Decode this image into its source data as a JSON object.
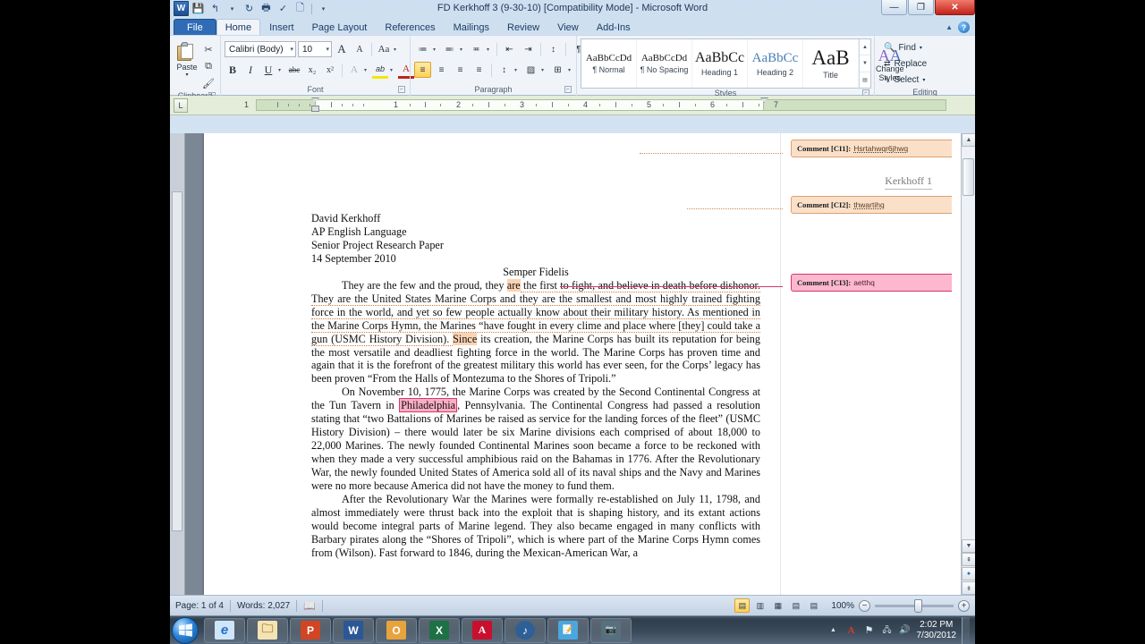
{
  "window": {
    "title": "FD Kerkhoff 3 (9-30-10) [Compatibility Mode]  -  Microsoft Word",
    "minimize_label": "—",
    "restore_label": "❐",
    "close_label": "✕",
    "help_label": "?",
    "collapse_ribbon_label": "▲"
  },
  "quick_access": {
    "items": [
      {
        "name": "word-logo",
        "glyph": "W"
      },
      {
        "name": "save",
        "glyph": "💾"
      },
      {
        "name": "undo",
        "glyph": "↰"
      },
      {
        "name": "undo-dropdown",
        "glyph": "▾"
      },
      {
        "name": "redo",
        "glyph": "↻"
      },
      {
        "name": "print",
        "glyph": "🖶"
      },
      {
        "name": "spelling",
        "glyph": "✓"
      },
      {
        "name": "new",
        "glyph": "🗋"
      },
      {
        "name": "customize",
        "glyph": "▾"
      }
    ]
  },
  "tabs": [
    {
      "label": "File",
      "active": false,
      "file": true
    },
    {
      "label": "Home",
      "active": true
    },
    {
      "label": "Insert",
      "active": false
    },
    {
      "label": "Page Layout",
      "active": false
    },
    {
      "label": "References",
      "active": false
    },
    {
      "label": "Mailings",
      "active": false
    },
    {
      "label": "Review",
      "active": false
    },
    {
      "label": "View",
      "active": false
    },
    {
      "label": "Add-Ins",
      "active": false
    }
  ],
  "ribbon": {
    "clipboard": {
      "group_label": "Clipboard",
      "paste_label": "Paste",
      "paste_arrow": "▾",
      "cut_label": "✂",
      "copy_label": "⧉",
      "format_painter_label": "🖌"
    },
    "font": {
      "group_label": "Font",
      "font_name": "Calibri (Body)",
      "font_size": "10",
      "grow_font": "A",
      "shrink_font": "A",
      "change_case": "Aa",
      "bold": "B",
      "italic": "I",
      "underline": "U",
      "strikethrough": "abc",
      "subscript": "x₂",
      "superscript": "x²",
      "clear_formatting": "A",
      "text_highlight": "ab",
      "font_color": "A",
      "dropdown_arrow": "▾"
    },
    "paragraph": {
      "group_label": "Paragraph",
      "bullets": "≔",
      "numbering": "≕",
      "multilevel": "≖",
      "decrease_indent": "⇤",
      "increase_indent": "⇥",
      "sort": "↕",
      "show_marks": "¶",
      "align_left": "≡",
      "align_center": "≡",
      "align_right": "≡",
      "justify": "≡",
      "line_spacing": "↕",
      "shading": "▨",
      "borders": "⊞",
      "dropdown_arrow": "▾"
    },
    "styles": {
      "group_label": "Styles",
      "items": [
        {
          "preview": "AaBbCcDd",
          "name": "¶ Normal",
          "size": "11px",
          "color": "#1a1a1a"
        },
        {
          "preview": "AaBbCcDd",
          "name": "¶ No Spacing",
          "size": "11px",
          "color": "#1a1a1a"
        },
        {
          "preview": "AaBbCc",
          "name": "Heading 1",
          "size": "16px",
          "color": "#1a1a1a"
        },
        {
          "preview": "AaBbCc",
          "name": "Heading 2",
          "size": "15px",
          "color": "#4a7eb5"
        },
        {
          "preview": "AaB",
          "name": "Title",
          "size": "22px",
          "color": "#1a1a1a"
        }
      ],
      "change_styles_label": "Change Styles",
      "change_styles_arrow": "▾"
    },
    "editing": {
      "group_label": "Editing",
      "find_label": "Find",
      "replace_label": "Replace",
      "select_label": "Select",
      "dropdown_arrow": "▾"
    }
  },
  "ruler": {
    "tab_selector": "L",
    "numbers": [
      "1",
      "2",
      "3",
      "4",
      "5",
      "6",
      "7"
    ]
  },
  "document": {
    "header_text": "Kerkhoff 1",
    "heading_block": [
      "David Kerkhoff",
      "AP English Language",
      "Senior Project Research Paper",
      "14 September 2010"
    ],
    "title": "Semper Fidelis",
    "paragraph1": {
      "pre": "They are the few and the proud, they ",
      "hl1": "are",
      "mid1": " the first to fight, and believe in death before dishonor. They are the United States Marine Corps and they are the smallest and most highly trained fighting force in the world, and yet so few people actually know about their military history.  As mentioned in the Marine Corps Hymn, the Marines “have fought in every clime and place where [they] could take a gun (USMC History Division).  ",
      "hl2": "Since",
      "post": " its creation, the Marine Corps has built its reputation for being the most versatile and deadliest fighting force in the world.  The Marine Corps has proven time and again that it is the forefront of the greatest military this world has ever seen, for the Corps’  legacy has been proven “From the Halls of Montezuma to the Shores of Tripoli.”"
    },
    "paragraph2": {
      "pre": "On November 10, 1775, the Marine Corps was created by the Second Continental Congress at the Tun Tavern in ",
      "hl": "Philadelphia",
      "post": ", Pennsylvania.  The Continental Congress had passed a resolution stating that “two Battalions of Marines be raised as service for the landing forces of the fleet” (USMC History Division) – there would later be six Marine divisions each comprised of about 18,000 to 22,000 Marines.  The newly founded Continental Marines soon became a force to be reckoned with when they made a very successful amphibious raid on the Bahamas in 1776. After the Revolutionary War, the newly founded United States of America sold all of its naval ships and the Navy and Marines were no more because America did not have the money to fund them."
    },
    "paragraph3": "After the Revolutionary War the Marines were  formally re-established on July 11, 1798, and almost immediately were thrust back into the exploit that is shaping history, and its extant actions would become integral parts of Marine legend. They also became engaged in many conflicts with Barbary pirates along the “Shores of Tripoli”, which is where part of the Marine Corps Hymn comes from (Wilson).  Fast forward to 1846, during the Mexican-American War, a"
  },
  "comments": [
    {
      "label": "Comment [CI1]:",
      "text": "Hsrtahwqr6jhwq",
      "color": "orange"
    },
    {
      "label": "Comment [CI2]:",
      "text": "thwartihq",
      "color": "orange"
    },
    {
      "label": "Comment [CI3]:",
      "text": "aetthq",
      "color": "pink"
    }
  ],
  "status_bar": {
    "page_label": "Page: 1 of 4",
    "words_label": "Words: 2,027",
    "proofing_icon": "proofing-errors-icon",
    "view_buttons": [
      {
        "name": "print-layout-view",
        "glyph": "▤",
        "active": true
      },
      {
        "name": "full-screen-reading-view",
        "glyph": "▥",
        "active": false
      },
      {
        "name": "web-layout-view",
        "glyph": "▦",
        "active": false
      },
      {
        "name": "outline-view",
        "glyph": "▤",
        "active": false
      },
      {
        "name": "draft-view",
        "glyph": "▤",
        "active": false
      }
    ],
    "zoom_level": "100%",
    "zoom_out": "−",
    "zoom_in": "+"
  },
  "taskbar": {
    "start_label": "Start",
    "items": [
      {
        "name": "internet-explorer",
        "glyph": "e",
        "color": "#1f6fc4",
        "bg": "#cfe6fa"
      },
      {
        "name": "windows-explorer",
        "glyph": "🗀",
        "color": "#b08a30",
        "bg": "#f4e3b4"
      },
      {
        "name": "powerpoint",
        "glyph": "P",
        "color": "#ffffff",
        "bg": "#d14524"
      },
      {
        "name": "word",
        "glyph": "W",
        "color": "#ffffff",
        "bg": "#2b5797"
      },
      {
        "name": "outlook",
        "glyph": "O",
        "color": "#ffffff",
        "bg": "#e8a33d"
      },
      {
        "name": "excel",
        "glyph": "X",
        "color": "#ffffff",
        "bg": "#1e7145"
      },
      {
        "name": "adobe-reader",
        "glyph": "A",
        "color": "#ffffff",
        "bg": "#c8102e"
      },
      {
        "name": "itunes",
        "glyph": "♪",
        "color": "#ffffff",
        "bg": "#2e5f97"
      },
      {
        "name": "notepad",
        "glyph": "📝",
        "color": "#ffffff",
        "bg": "#4aa7de"
      },
      {
        "name": "camera-app",
        "glyph": "📷",
        "color": "#ffffff",
        "bg": "#56707f"
      }
    ],
    "tray": {
      "show_hidden": "▲",
      "adobe": "A",
      "network": "⚑",
      "connection": "🖧",
      "volume": "🔊",
      "time": "2:02 PM",
      "date": "7/30/2012"
    }
  }
}
